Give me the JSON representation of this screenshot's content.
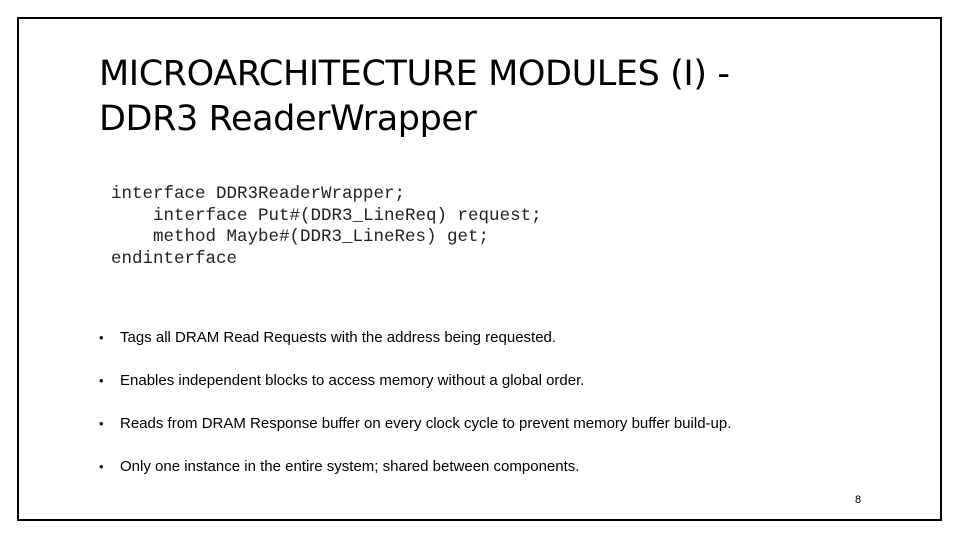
{
  "slide": {
    "title_line1": "MICROARCHITECTURE MODULES (I) -",
    "title_line2": "DDR3 ReaderWrapper",
    "code": {
      "lines": [
        "interface DDR3ReaderWrapper;",
        "    interface Put#(DDR3_LineReq) request;",
        "    method Maybe#(DDR3_LineRes) get;",
        "endinterface"
      ]
    },
    "bullets": [
      {
        "icon": "bullet-dot",
        "symbol": "•",
        "text": "Tags all DRAM Read Requests with the address being requested."
      },
      {
        "icon": "bullet-dot",
        "symbol": "•",
        "text": "Enables independent blocks to access memory without a global order."
      },
      {
        "icon": "bullet-dot",
        "symbol": "•",
        "text": "Reads from DRAM Response buffer on every clock cycle to prevent memory buffer build-up."
      },
      {
        "icon": "bullet-dot",
        "symbol": "•",
        "text": "Only one instance in the entire system; shared between components."
      }
    ],
    "page_number": "8"
  },
  "colors": {
    "background": "#ffffff",
    "frame": "#000000",
    "text": "#000000",
    "code_text": "#222222"
  }
}
